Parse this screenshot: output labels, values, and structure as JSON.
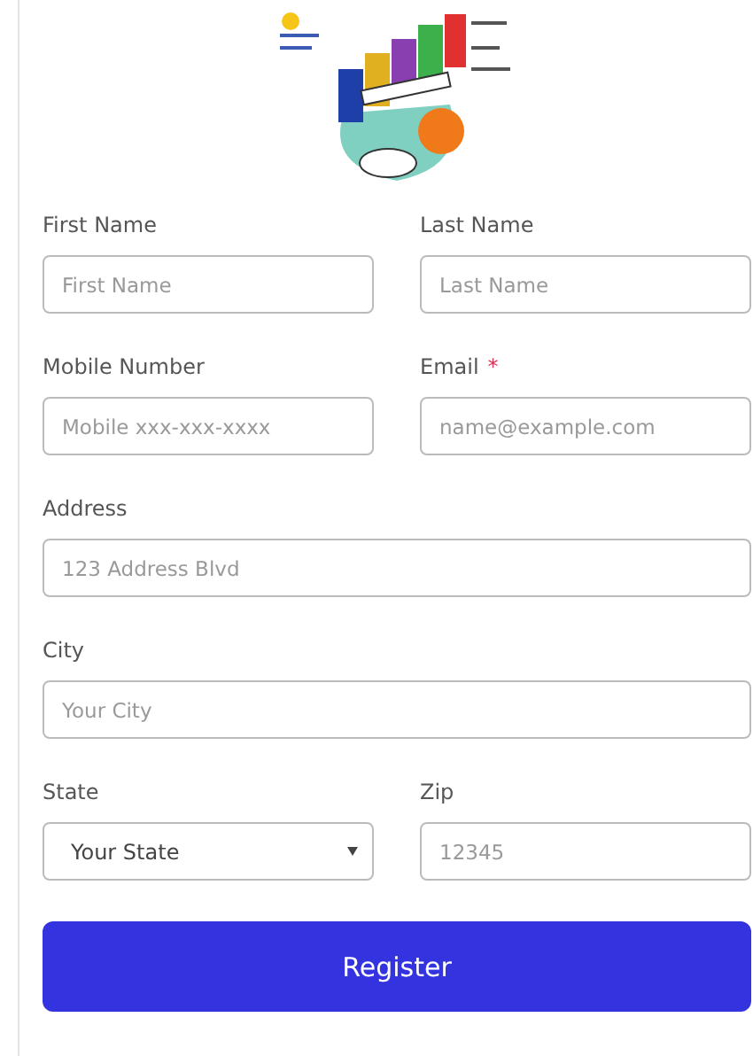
{
  "form": {
    "rows": [
      [
        {
          "label": "First Name",
          "kind": "text",
          "placeholder": "First Name"
        },
        {
          "label": "Last Name",
          "kind": "text",
          "placeholder": "Last Name"
        }
      ],
      [
        {
          "label": "Mobile Number",
          "kind": "text",
          "placeholder": "Mobile xxx-xxx-xxxx"
        },
        {
          "label": "Email",
          "kind": "text",
          "placeholder": "name@example.com",
          "required_mark": "*"
        }
      ],
      [
        {
          "label": "Address",
          "kind": "text",
          "placeholder": "123 Address Blvd"
        }
      ],
      [
        {
          "label": "City",
          "kind": "text",
          "placeholder": "Your City"
        }
      ],
      [
        {
          "label": "State",
          "kind": "select",
          "value": "Your State"
        },
        {
          "label": "Zip",
          "kind": "text",
          "placeholder": "12345"
        }
      ]
    ],
    "submit": {
      "label": "Register"
    }
  }
}
